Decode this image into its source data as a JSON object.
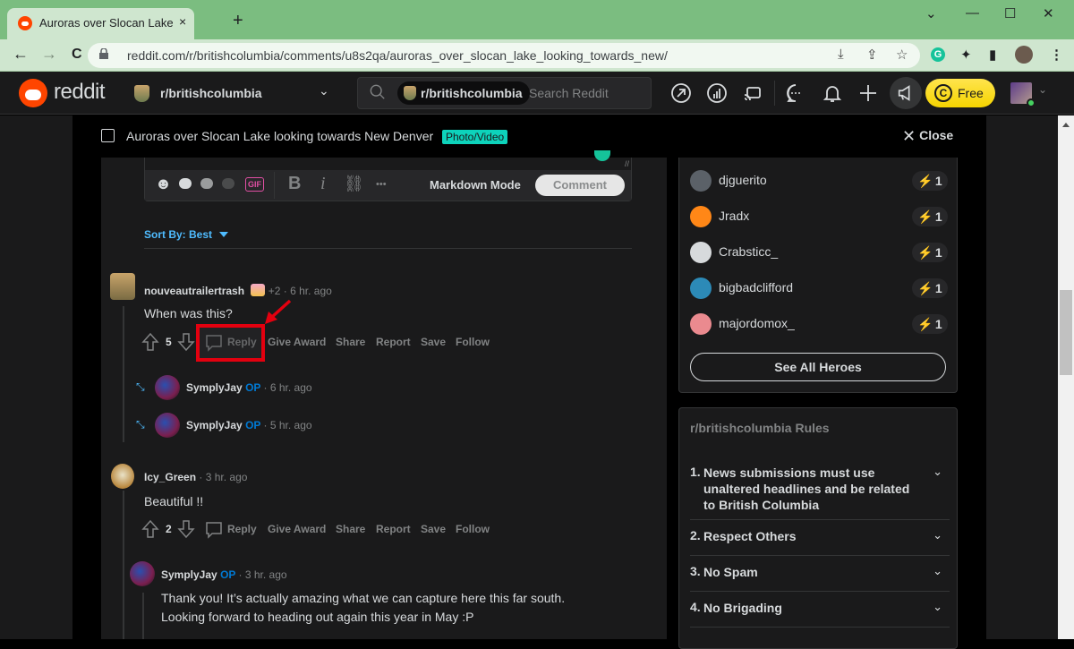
{
  "browser": {
    "tab_title": "Auroras over Slocan Lake looking towards New Denver",
    "tab_close": "×",
    "new_tab": "+",
    "url": "reddit.com/r/britishcolumbia/comments/u8s2qa/auroras_over_slocan_lake_looking_towards_new/",
    "window_controls": [
      "⌄",
      "—",
      "☐",
      "✕"
    ],
    "nav": {
      "back": "←",
      "forward": "→",
      "reload": "C"
    },
    "omnibox_icons": [
      "⤓",
      "⇪",
      "☆"
    ],
    "extension_icons": [
      "G",
      "✦",
      "▮",
      "●",
      "⋮"
    ]
  },
  "header": {
    "logo_text": "reddit",
    "community": "r/britishcolumbia",
    "community_chevron": "⌄",
    "search_chip": "r/britishcolumbia",
    "search_placeholder": "Search Reddit",
    "coins_label": "Free",
    "coins_glyph": "C",
    "user_chevron": "⌄"
  },
  "post_bar": {
    "title": "Auroras over Slocan Lake looking towards New Denver",
    "flair": "Photo/Video",
    "close_glyph": "✕",
    "close_label": "Close"
  },
  "editor": {
    "markdown_mode": "Markdown Mode",
    "comment_button": "Comment",
    "gif_label": "GIF",
    "tools": [
      "☻",
      "B",
      "i",
      "⛓",
      "•••"
    ]
  },
  "sort": {
    "label": "Sort By: Best"
  },
  "comments": [
    {
      "author": "nouveautrailertrash",
      "flair": "+2",
      "time": "· 6 hr. ago",
      "body": "When was this?",
      "score": "5",
      "actions": [
        "Reply",
        "Give Award",
        "Share",
        "Report",
        "Save",
        "Follow"
      ],
      "replies": [
        {
          "author": "SymplyJay",
          "op": "OP",
          "time": "· 6 hr. ago"
        },
        {
          "author": "SymplyJay",
          "op": "OP",
          "time": "· 5 hr. ago"
        }
      ]
    },
    {
      "author": "Icy_Green",
      "time": "· 3 hr. ago",
      "body": "Beautiful !!",
      "score": "2",
      "actions": [
        "Reply",
        "Give Award",
        "Share",
        "Report",
        "Save",
        "Follow"
      ],
      "replies": [
        {
          "author": "SymplyJay",
          "op": "OP",
          "time": "· 3 hr. ago",
          "body_lines": [
            "Thank you! It’s actually amazing what we can capture here this far south.",
            "Looking forward to heading out again this year in May :P"
          ]
        }
      ]
    }
  ],
  "heroes": {
    "items": [
      {
        "name": "djguerito",
        "count": "1",
        "color": "#5b6168"
      },
      {
        "name": "Jradx",
        "count": "1",
        "color": "#ff8717"
      },
      {
        "name": "Crabsticc_",
        "count": "1",
        "color": "#d7dadc"
      },
      {
        "name": "bigbadclifford",
        "count": "1",
        "color": "#2c8ab7"
      },
      {
        "name": "majordomox_",
        "count": "1",
        "color": "#ea8a8f"
      }
    ],
    "bolt": "⚡",
    "see_all": "See All Heroes"
  },
  "rules": {
    "heading": "r/britishcolumbia Rules",
    "items": [
      {
        "num": "1.",
        "text": "News submissions must use unaltered headlines and be related to British Columbia"
      },
      {
        "num": "2.",
        "text": "Respect Others"
      },
      {
        "num": "3.",
        "text": "No Spam"
      },
      {
        "num": "4.",
        "text": "No Brigading"
      }
    ],
    "chevron": "⌄"
  },
  "colors": {
    "brand": "#ff4500",
    "accent_blue": "#4fbcff",
    "op_blue": "#0079d3",
    "highlight_red": "#e3000f",
    "flair_teal": "#0dd3bb",
    "coins_yellow": "#ffe44d"
  }
}
